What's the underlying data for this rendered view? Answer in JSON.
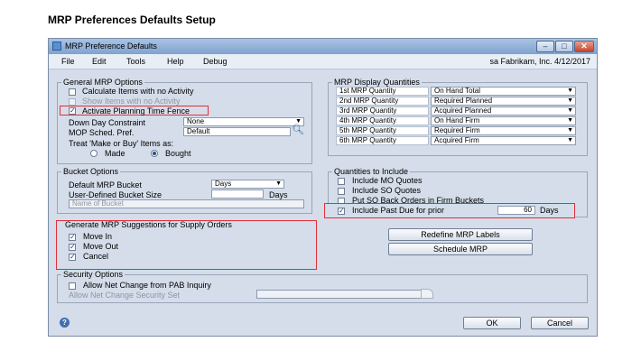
{
  "doc_title": "MRP Preferences Defaults Setup",
  "window": {
    "title": "MRP Preference Defaults",
    "minimize": "–",
    "maximize": "□",
    "close": "✕"
  },
  "menu": [
    "File",
    "Edit",
    "Tools",
    "Help",
    "Debug"
  ],
  "user_info": "sa  Fabrikam, Inc.  4/12/2017",
  "general": {
    "legend": "General MRP Options",
    "options": [
      {
        "label": "Calculate Items with no Activity",
        "checked": false,
        "disabled": false
      },
      {
        "label": "Show Items with no Activity",
        "checked": false,
        "disabled": true
      },
      {
        "label": "Activate Planning Time Fence",
        "checked": true,
        "disabled": false
      }
    ],
    "down_day_label": "Down Day Constraint",
    "down_day_value": "None",
    "mop_label": "MOP Sched. Pref.",
    "mop_value": "Default",
    "treat_label": "Treat 'Make or Buy' Items as:",
    "made_label": "Made",
    "bought_label": "Bought",
    "selected": "Bought"
  },
  "bucket": {
    "legend": "Bucket Options",
    "default_label": "Default MRP Bucket",
    "default_value": "Days",
    "user_label": "User-Defined Bucket Size",
    "user_unit": "Days",
    "name_label": "Name of Bucket"
  },
  "suggestions": {
    "legend": "Generate MRP Suggestions for Supply Orders",
    "items": [
      {
        "label": "Move In",
        "checked": true
      },
      {
        "label": "Move Out",
        "checked": true
      },
      {
        "label": "Cancel",
        "checked": true
      }
    ]
  },
  "display": {
    "legend": "MRP Display Quantities",
    "rows": [
      {
        "label": "1st MRP Quantity",
        "value": "On Hand Total"
      },
      {
        "label": "2nd MRP Quantity",
        "value": "Required Planned"
      },
      {
        "label": "3rd MRP Quantity",
        "value": "Acquired Planned"
      },
      {
        "label": "4th MRP Quantity",
        "value": "On Hand Firm"
      },
      {
        "label": "5th MRP Quantity",
        "value": "Required Firm"
      },
      {
        "label": "6th MRP Quantity",
        "value": "Acquired Firm"
      }
    ]
  },
  "include": {
    "legend": "Quantities to Include",
    "options": [
      {
        "label": "Include MO Quotes",
        "checked": false
      },
      {
        "label": "Include SO Quotes",
        "checked": false
      },
      {
        "label": "Put SO Back Orders in Firm Buckets",
        "checked": false
      },
      {
        "label": "Include Past Due for prior",
        "checked": true
      }
    ],
    "past_due_value": "60",
    "past_due_unit": "Days"
  },
  "buttons": {
    "redefine": "Redefine MRP Labels",
    "schedule": "Schedule MRP",
    "ok": "OK",
    "cancel": "Cancel"
  },
  "security": {
    "legend": "Security Options",
    "allow_label": "Allow Net Change from PAB Inquiry",
    "allow_checked": false,
    "security_set_label": "Allow Net Change Security Set"
  },
  "colors": {
    "highlight": "#e0303a",
    "window_bg": "#d4dde9"
  }
}
